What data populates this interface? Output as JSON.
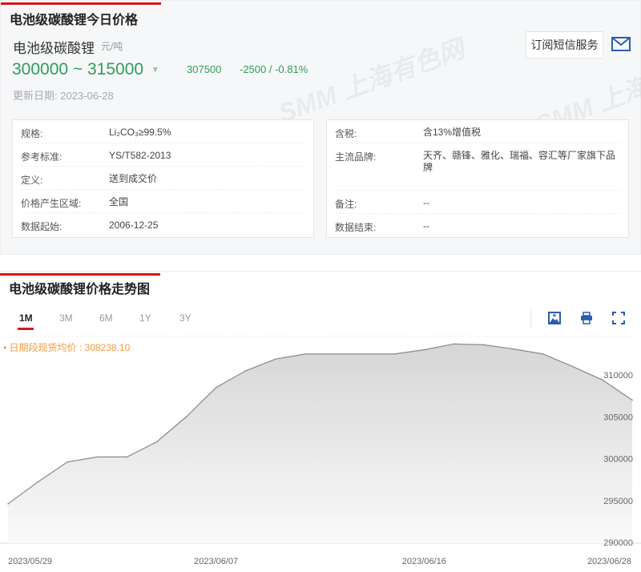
{
  "header": {
    "title": "电池级碳酸锂今日价格",
    "product": "电池级碳酸锂",
    "unit": "元/吨",
    "range": "300000 ~ 315000",
    "avg": "307500",
    "change": "-2500  /  -0.81%",
    "update_label": "更新日期:",
    "update_date": "2023-06-28",
    "subscribe": "订阅短信服务"
  },
  "watermark": "SMM 上海有色网",
  "info_left": [
    {
      "k": "规格:",
      "v": "Li₂CO₃≥99.5%"
    },
    {
      "k": "参考标准:",
      "v": "YS/T582-2013"
    },
    {
      "k": "定义:",
      "v": "送到成交价"
    },
    {
      "k": "价格产生区域:",
      "v": "全国"
    },
    {
      "k": "数据起始:",
      "v": "2006-12-25"
    }
  ],
  "info_right": [
    {
      "k": "含税:",
      "v": "含13%增值税"
    },
    {
      "k": "主流品牌:",
      "v": "天齐、赣锋、雅化、瑞福、容汇等厂家旗下品牌"
    },
    {
      "k": "备注:",
      "v": "--"
    },
    {
      "k": "数据结束:",
      "v": "--"
    }
  ],
  "trend": {
    "title": "电池级碳酸锂价格走势图",
    "tabs": [
      "1M",
      "3M",
      "6M",
      "1Y",
      "3Y"
    ],
    "active_tab": "1M",
    "avg_text": "• 日期段现货均价 : 308238.10"
  },
  "chart_data": {
    "type": "area",
    "x": [
      "2023/05/29",
      "2023/05/30",
      "2023/05/31",
      "2023/06/01",
      "2023/06/02",
      "2023/06/05",
      "2023/06/06",
      "2023/06/07",
      "2023/06/08",
      "2023/06/09",
      "2023/06/12",
      "2023/06/13",
      "2023/06/14",
      "2023/06/15",
      "2023/06/16",
      "2023/06/19",
      "2023/06/20",
      "2023/06/21",
      "2023/06/25",
      "2023/06/26",
      "2023/06/27",
      "2023/06/28"
    ],
    "values": [
      294600,
      297200,
      299600,
      300200,
      300200,
      302000,
      305000,
      308500,
      310500,
      311900,
      312500,
      312500,
      312500,
      312500,
      313000,
      313700,
      313600,
      313100,
      312500,
      311000,
      309400,
      307000
    ],
    "x_tick_labels": [
      "2023/05/29",
      "2023/06/07",
      "2023/06/16",
      "2023/06/28"
    ],
    "x_tick_index": [
      0,
      7,
      14,
      21
    ],
    "y_ticks": [
      290000,
      295000,
      300000,
      305000,
      310000
    ],
    "ylim": [
      289000,
      316000
    ],
    "color": "#888888"
  }
}
